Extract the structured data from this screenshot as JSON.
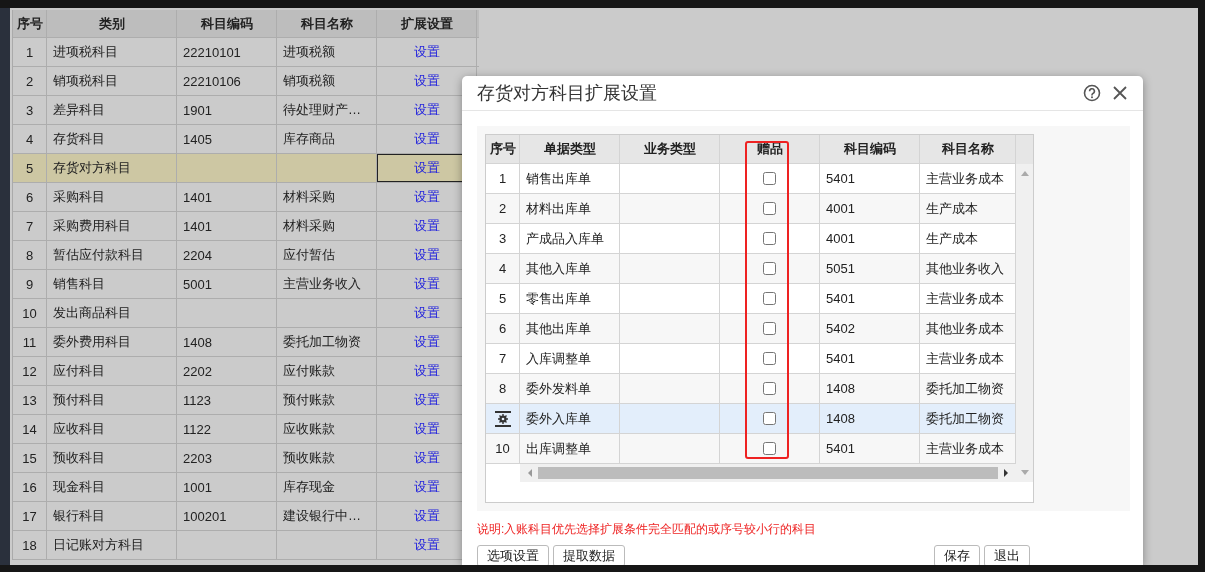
{
  "background_table": {
    "columns": [
      "序号",
      "类别",
      "科目编码",
      "科目名称",
      "扩展设置"
    ],
    "rows": [
      {
        "seq": "1",
        "category": "进项税科目",
        "code": "22210101",
        "name": "进项税额",
        "action": "设置",
        "selected": false
      },
      {
        "seq": "2",
        "category": "销项税科目",
        "code": "22210106",
        "name": "销项税额",
        "action": "设置",
        "selected": false
      },
      {
        "seq": "3",
        "category": "差异科目",
        "code": "1901",
        "name": "待处理财产…",
        "action": "设置",
        "selected": false
      },
      {
        "seq": "4",
        "category": "存货科目",
        "code": "1405",
        "name": "库存商品",
        "action": "设置",
        "selected": false
      },
      {
        "seq": "5",
        "category": "存货对方科目",
        "action": "设置",
        "selected": true
      },
      {
        "seq": "6",
        "category": "采购科目",
        "code": "1401",
        "name": "材料采购",
        "action": "设置",
        "selected": false
      },
      {
        "seq": "7",
        "category": "采购费用科目",
        "code": "1401",
        "name": "材料采购",
        "action": "设置",
        "selected": false
      },
      {
        "seq": "8",
        "category": "暂估应付款科目",
        "code": "2204",
        "name": "应付暂估",
        "action": "设置",
        "selected": false
      },
      {
        "seq": "9",
        "category": "销售科目",
        "code": "5001",
        "name": "主营业务收入",
        "action": "设置",
        "selected": false
      },
      {
        "seq": "10",
        "category": "发出商品科目",
        "action": "设置",
        "selected": false
      },
      {
        "seq": "11",
        "category": "委外费用科目",
        "code": "1408",
        "name": "委托加工物资",
        "action": "设置",
        "selected": false
      },
      {
        "seq": "12",
        "category": "应付科目",
        "code": "2202",
        "name": "应付账款",
        "action": "设置",
        "selected": false
      },
      {
        "seq": "13",
        "category": "预付科目",
        "code": "1123",
        "name": "预付账款",
        "action": "设置",
        "selected": false
      },
      {
        "seq": "14",
        "category": "应收科目",
        "code": "1122",
        "name": "应收账款",
        "action": "设置",
        "selected": false
      },
      {
        "seq": "15",
        "category": "预收科目",
        "code": "2203",
        "name": "预收账款",
        "action": "设置",
        "selected": false
      },
      {
        "seq": "16",
        "category": "现金科目",
        "code": "1001",
        "name": "库存现金",
        "action": "设置",
        "selected": false
      },
      {
        "seq": "17",
        "category": "银行科目",
        "code": "100201",
        "name": "建设银行中…",
        "action": "设置",
        "selected": false
      },
      {
        "seq": "18",
        "category": "日记账对方科目",
        "action": "设置",
        "selected": false
      }
    ]
  },
  "dialog": {
    "title": "存货对方科目扩展设置",
    "grid": {
      "columns": [
        {
          "label": "序号",
          "highlighted": false
        },
        {
          "label": "单据类型",
          "highlighted": false
        },
        {
          "label": "业务类型",
          "highlighted": false
        },
        {
          "label": "赠品",
          "highlighted": true
        },
        {
          "label": "科目编码",
          "highlighted": false
        },
        {
          "label": "科目名称",
          "highlighted": false
        }
      ],
      "rows": [
        {
          "seq": "1",
          "doc_type": "销售出库单",
          "gift": false,
          "code": "5401",
          "name": "主营业务成本",
          "selected": false
        },
        {
          "seq": "2",
          "doc_type": "材料出库单",
          "gift": false,
          "code": "4001",
          "name": "生产成本",
          "selected": false
        },
        {
          "seq": "3",
          "doc_type": "产成品入库单",
          "gift": false,
          "code": "4001",
          "name": "生产成本",
          "selected": false
        },
        {
          "seq": "4",
          "doc_type": "其他入库单",
          "gift": false,
          "code": "5051",
          "name": "其他业务收入",
          "selected": false
        },
        {
          "seq": "5",
          "doc_type": "零售出库单",
          "gift": false,
          "code": "5401",
          "name": "主营业务成本",
          "selected": false
        },
        {
          "seq": "6",
          "doc_type": "其他出库单",
          "gift": false,
          "code": "5402",
          "name": "其他业务成本",
          "selected": false
        },
        {
          "seq": "7",
          "doc_type": "入库调整单",
          "gift": false,
          "code": "5401",
          "name": "主营业务成本",
          "selected": false
        },
        {
          "seq": "8",
          "doc_type": "委外发料单",
          "gift": false,
          "code": "1408",
          "name": "委托加工物资",
          "selected": false
        },
        {
          "doc_type": "委外入库单",
          "gift": false,
          "code": "1408",
          "name": "委托加工物资",
          "selected": true
        },
        {
          "seq": "10",
          "doc_type": "出库调整单",
          "gift": false,
          "code": "5401",
          "name": "主营业务成本",
          "selected": false
        }
      ]
    },
    "note": "说明:入账科目优先选择扩展条件完全匹配的或序号较小行的科目",
    "buttons_left": [
      "选项设置",
      "提取数据"
    ],
    "buttons_right": [
      "保存",
      "退出"
    ]
  }
}
